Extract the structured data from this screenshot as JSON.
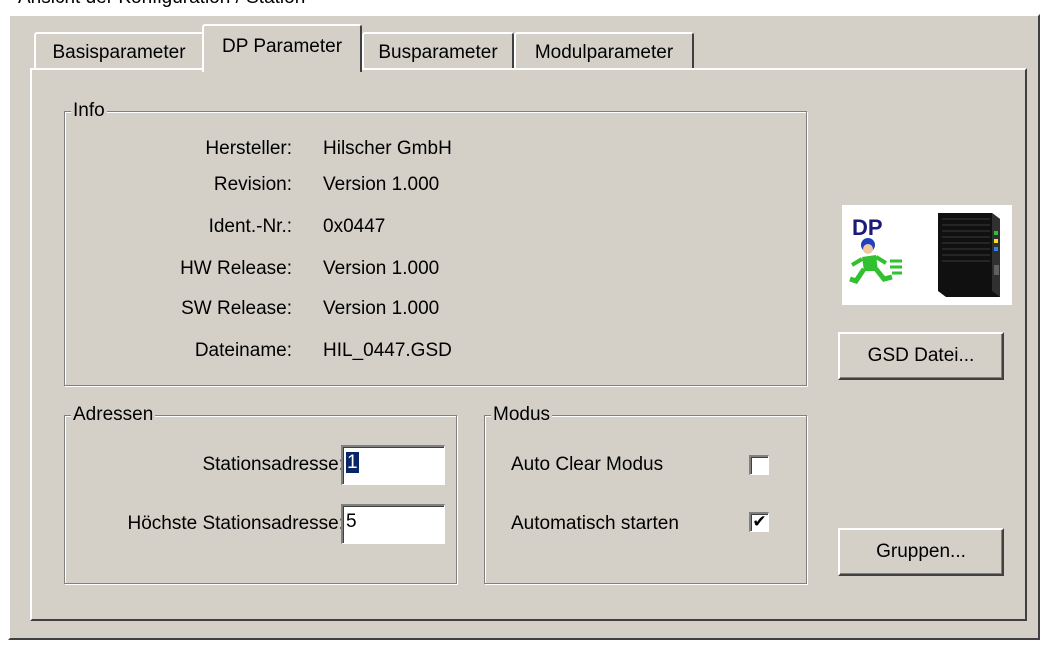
{
  "top_clip_text": "Ansicht der Konfiguration / Station",
  "tabs": [
    {
      "label": "Basisparameter",
      "active": false
    },
    {
      "label": "DP Parameter",
      "active": true
    },
    {
      "label": "Busparameter",
      "active": false
    },
    {
      "label": "Modulparameter",
      "active": false
    }
  ],
  "info": {
    "title": "Info",
    "rows": [
      {
        "label": "Hersteller:",
        "value": "Hilscher GmbH"
      },
      {
        "label": "Revision:",
        "value": "Version 1.000"
      },
      {
        "label": "Ident.-Nr.:",
        "value": "0x0447"
      },
      {
        "label": "HW Release:",
        "value": "Version 1.000"
      },
      {
        "label": "SW Release:",
        "value": "Version 1.000"
      },
      {
        "label": "Dateiname:",
        "value": "HIL_0447.GSD"
      }
    ]
  },
  "adressen": {
    "title": "Adressen",
    "station_label": "Stationsadresse:",
    "station_value": "1",
    "highest_label": "Höchste Stationsadresse:",
    "highest_value": "5"
  },
  "modus": {
    "title": "Modus",
    "auto_clear_label": "Auto Clear Modus",
    "auto_clear_checked": false,
    "auto_start_label": "Automatisch starten",
    "auto_start_checked": true
  },
  "logo_text": "DP",
  "buttons": {
    "gsd": "GSD Datei...",
    "gruppen": "Gruppen..."
  },
  "colors": {
    "dialog_bg": "#d4d0c8",
    "selection": "#0a246a"
  }
}
